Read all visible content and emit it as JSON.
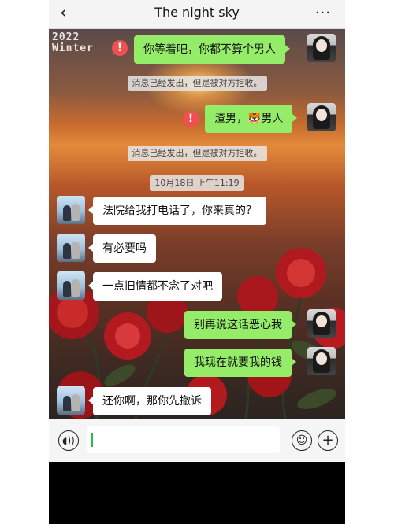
{
  "header": {
    "title": "The night sky",
    "back_icon": "‹",
    "more_icon": "···"
  },
  "watermark": {
    "line1": "2022",
    "line2": "Winter"
  },
  "messages": {
    "m1": "你等着吧，你都不算个男人",
    "sys1": "消息已经发出，但是被对方拒收。",
    "m2_prefix": "渣男，",
    "m2_emoji": "🐯",
    "m2_suffix": "男人",
    "sys2": "消息已经发出，但是被对方拒收。",
    "timestamp": "10月18日 上午11:19",
    "m3": "法院给我打电话了，你来真的？",
    "m4": "有必要吗",
    "m5": "一点旧情都不念了对吧",
    "m6": "别再说这话恶心我",
    "m7": "我现在就要我的钱",
    "m8": "还你啊，那你先撤诉"
  },
  "icons": {
    "error": "!",
    "voice": "◖))",
    "emoji": "☺",
    "plus": "+"
  },
  "colors": {
    "sent_bubble": "#95ec69",
    "received_bubble": "#ffffff",
    "error_badge": "#f05050",
    "caret": "#2db84d"
  }
}
